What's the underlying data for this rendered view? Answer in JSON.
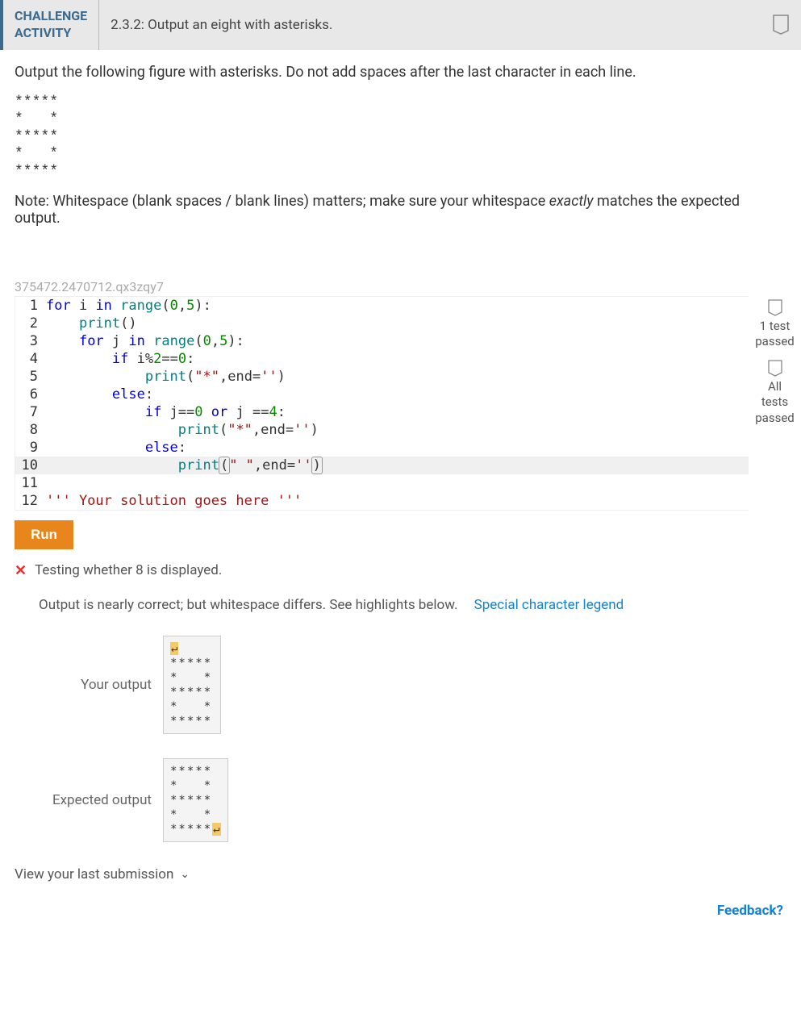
{
  "header": {
    "challenge_label_1": "CHALLENGE",
    "challenge_label_2": "ACTIVITY",
    "title": "2.3.2: Output an eight with asterisks."
  },
  "instructions": {
    "line1": "Output the following figure with asterisks. Do not add spaces after the last character in each line.",
    "figure": "*****\n*   *\n*****\n*   *\n*****",
    "note_prefix": "Note: Whitespace (blank spaces / blank lines) matters; make sure your whitespace ",
    "note_em": "exactly",
    "note_suffix": " matches the expected output."
  },
  "qid": "375472.2470712.qx3zqy7",
  "code": {
    "lines": [
      "for i in range(0,5):",
      "    print()",
      "    for j in range(0,5):",
      "        if i%2==0:",
      "            print(\"*\",end='')",
      "        else:",
      "            if j==0 or j ==4:",
      "                print(\"*\",end='')",
      "            else:",
      "                print(\" \",end='')",
      "",
      "''' Your solution goes here '''"
    ]
  },
  "side_status": {
    "t1": "1 test passed",
    "t2_a": "All",
    "t2_b": "tests",
    "t2_c": "passed"
  },
  "run_label": "Run",
  "test_result": {
    "text": "Testing whether 8 is displayed."
  },
  "feedback_msg": "Output is nearly correct; but whitespace differs. See highlights below.",
  "legend_text": "Special character legend",
  "outputs": {
    "your_label": "Your output",
    "your_value_highlight": "↵",
    "your_value": "*****\n*   *\n*****\n*   *\n*****",
    "expected_label": "Expected output",
    "expected_value": "*****\n*   *\n*****\n*   *\n*****",
    "expected_trail_highlight": "↵"
  },
  "last_submission": "View your last submission",
  "feedback_link": "Feedback?"
}
